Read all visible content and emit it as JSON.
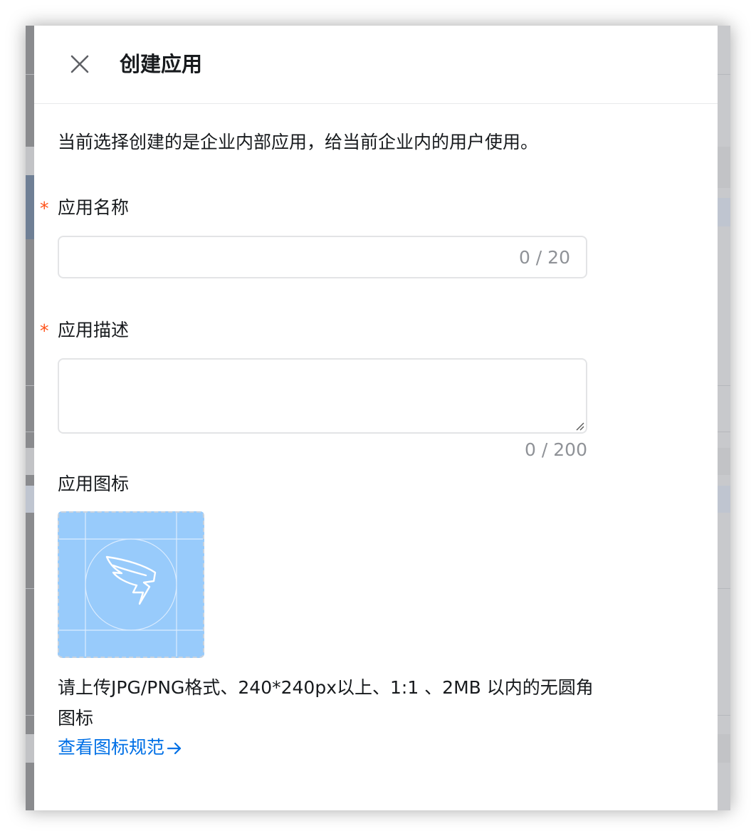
{
  "drawer": {
    "title": "创建应用",
    "close_icon": "close-icon",
    "intro": "当前选择创建的是企业内部应用，给当前企业内的用户使用。"
  },
  "form": {
    "name": {
      "required_mark": "*",
      "label": "应用名称",
      "value": "",
      "count": "0 / 20"
    },
    "description": {
      "required_mark": "*",
      "label": "应用描述",
      "value": "",
      "count": "0 / 200"
    },
    "icon": {
      "label": "应用图标",
      "placeholder_icon": "dingtalk-wing-icon",
      "hint": "请上传JPG/PNG格式、240*240px以上、1:1 、2MB 以内的无圆角图标",
      "link_label": "查看图标规范",
      "link_icon": "arrow-right-icon"
    }
  },
  "colors": {
    "accent": "#0070e6",
    "required": "#ff5219",
    "icon_placeholder_bg": "#98cbfb",
    "text_primary": "#171a1d",
    "text_secondary": "#8f9297"
  }
}
